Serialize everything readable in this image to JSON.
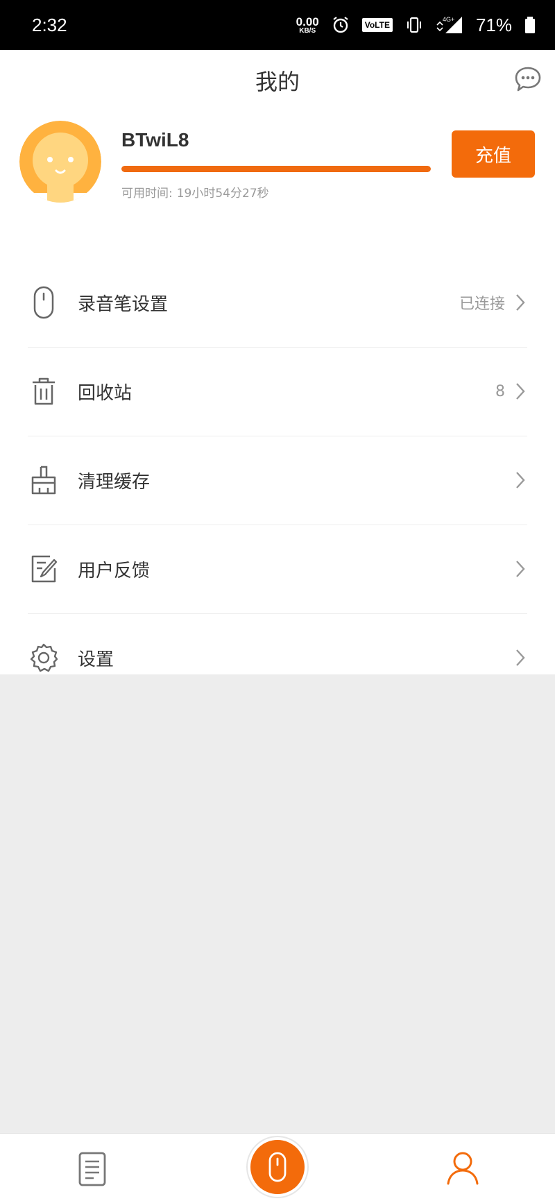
{
  "status_bar": {
    "time": "2:32",
    "net_speed_value": "0.00",
    "net_speed_unit": "KB/S",
    "volte": "VoLTE",
    "network": "4G+",
    "battery": "71%"
  },
  "header": {
    "title": "我的",
    "icon": "message-bubble-icon"
  },
  "profile": {
    "username": "BTwiL8",
    "progress_percent": 100,
    "available_label": "可用时间:",
    "available_value": "19小时54分27秒",
    "recharge_label": "充值"
  },
  "menu": {
    "items": [
      {
        "label": "录音笔设置",
        "value": "已连接",
        "icon": "recorder-pen-icon"
      },
      {
        "label": "回收站",
        "value": "8",
        "icon": "trash-icon"
      },
      {
        "label": "清理缓存",
        "value": "",
        "icon": "broom-icon"
      },
      {
        "label": "用户反馈",
        "value": "",
        "icon": "feedback-edit-icon"
      },
      {
        "label": "设置",
        "value": "",
        "icon": "gear-icon"
      }
    ]
  },
  "bottom_nav": {
    "items": [
      {
        "icon": "document-list-icon",
        "active": false
      },
      {
        "icon": "record-button-icon",
        "active": false
      },
      {
        "icon": "user-profile-icon",
        "active": true
      }
    ]
  },
  "colors": {
    "accent": "#F36B0B",
    "progress_track": "#F3D6C4",
    "avatar_outer": "#FFB23F",
    "avatar_inner": "#FFD680",
    "text_primary": "#333333",
    "text_secondary": "#999999"
  }
}
